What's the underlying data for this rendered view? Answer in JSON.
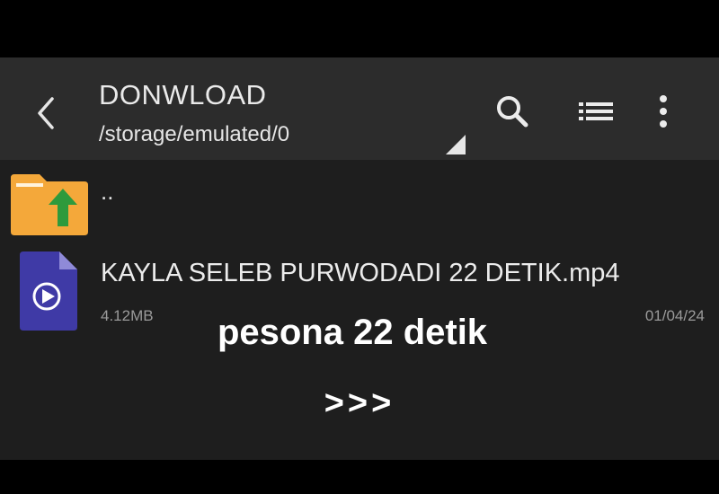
{
  "app_bar": {
    "title": "DONWLOAD",
    "path": "/storage/emulated/0",
    "icons": [
      "back-arrow-icon",
      "search-icon",
      "list-view-icon",
      "more-vert-icon"
    ]
  },
  "files": {
    "parent": {
      "label": "..",
      "icon": "folder-up-icon"
    },
    "items": [
      {
        "name": "KAYLA SELEB PURWODADI 22 DETIK.mp4",
        "size": "4.12MB",
        "date": "01/04/24",
        "icon": "video-file-icon"
      }
    ]
  },
  "overlay": {
    "caption": "pesona 22 detik",
    "arrows": ">>>"
  },
  "colors": {
    "app_bar_bg": "#2c2c2c",
    "content_bg": "#1e1e1e",
    "folder": "#f4a83a",
    "folder_arrow": "#2e9a3c",
    "video_file": "#3f3aa6"
  }
}
